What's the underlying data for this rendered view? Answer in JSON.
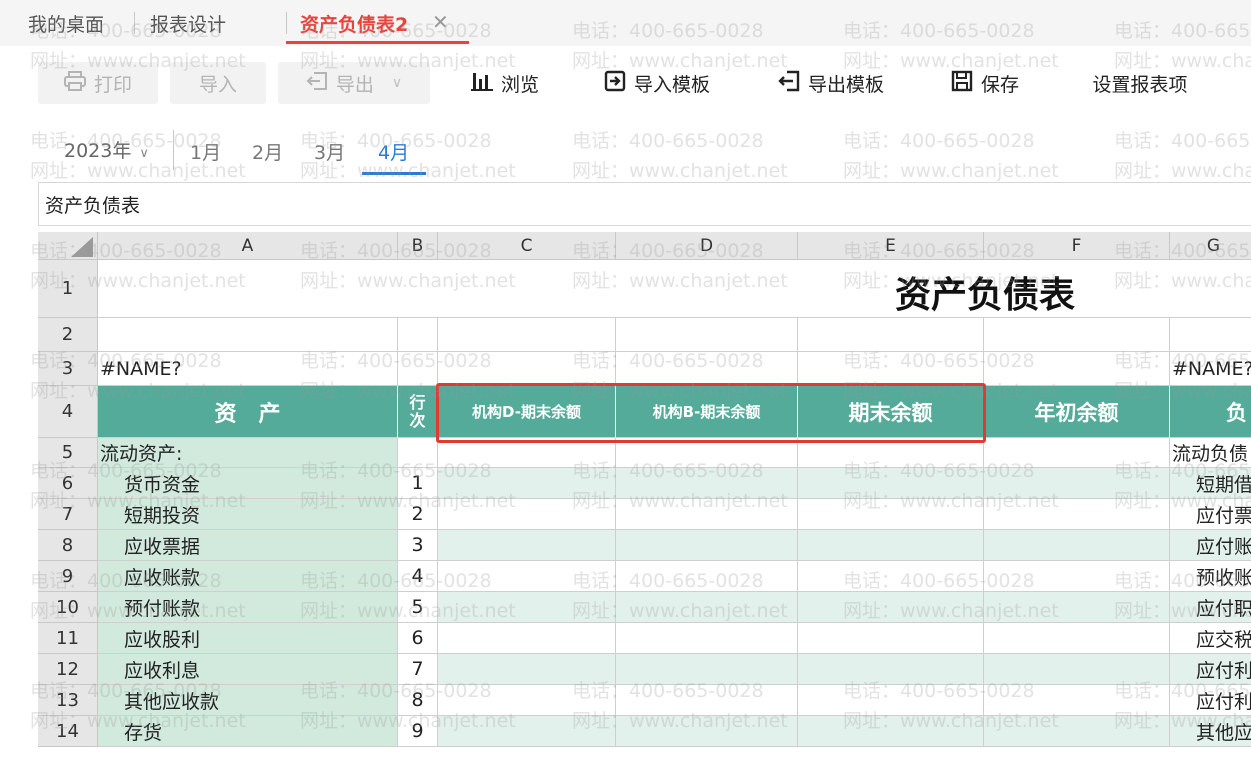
{
  "tabs": [
    {
      "label": "我的桌面"
    },
    {
      "label": "报表设计"
    },
    {
      "label": "资产负债表2",
      "active": true
    }
  ],
  "toolbar": {
    "print": "打印",
    "import": "导入",
    "export": "导出",
    "browse": "浏览",
    "import_template": "导入模板",
    "export_template": "导出模板",
    "save": "保存",
    "set_items": "设置报表项"
  },
  "period": {
    "year": "2023年",
    "months": [
      "1月",
      "2月",
      "3月",
      "4月"
    ],
    "selected_month": "4月"
  },
  "name_bar": "资产负债表",
  "watermark": {
    "phone": "电话：400-665-0028",
    "site": "网址：www.chanjet.net"
  },
  "grid": {
    "columns": [
      "A",
      "B",
      "C",
      "D",
      "E",
      "F",
      "G"
    ],
    "rows": [
      "1",
      "2",
      "3",
      "4",
      "5",
      "6",
      "7",
      "8",
      "9",
      "10",
      "11",
      "12",
      "13",
      "14"
    ],
    "title": "资产负债表",
    "row3_left": "#NAME?",
    "row3_right": "#NAME?",
    "header": {
      "asset": "资　产",
      "line_no": "行次",
      "col_c": "机构D-期末余额",
      "col_d": "机构B-期末余额",
      "col_e": "期末余额",
      "col_f": "年初余额",
      "col_g": "负"
    },
    "asset_items": [
      {
        "name": "流动资产:",
        "line": ""
      },
      {
        "name": "货币资金",
        "line": "1"
      },
      {
        "name": "短期投资",
        "line": "2"
      },
      {
        "name": "应收票据",
        "line": "3"
      },
      {
        "name": "应收账款",
        "line": "4"
      },
      {
        "name": "预付账款",
        "line": "5"
      },
      {
        "name": "应收股利",
        "line": "6"
      },
      {
        "name": "应收利息",
        "line": "7"
      },
      {
        "name": "其他应收款",
        "line": "8"
      },
      {
        "name": "存货",
        "line": "9"
      }
    ],
    "liability_items": [
      "流动负债",
      "短期借",
      "应付票",
      "应付账",
      "预收账",
      "应付职",
      "应交税",
      "应付利",
      "应付利",
      "其他应"
    ]
  },
  "colors": {
    "accent_red": "#e8433c",
    "accent_blue": "#2b7ad6",
    "header_green": "#54ab9a",
    "light_green": "#d2eadd",
    "highlight_box": "#e23a33"
  }
}
